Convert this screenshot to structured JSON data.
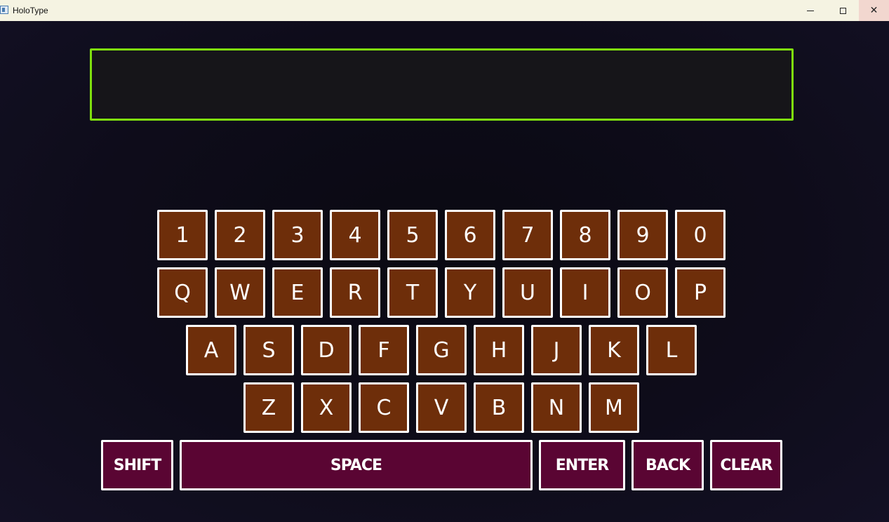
{
  "window": {
    "title": "HoloType",
    "minimize_glyph": "",
    "maximize_glyph": "",
    "close_glyph": "✕"
  },
  "display": {
    "text": ""
  },
  "keyboard": {
    "row1": [
      "1",
      "2",
      "3",
      "4",
      "5",
      "6",
      "7",
      "8",
      "9",
      "0"
    ],
    "row2": [
      "Q",
      "W",
      "E",
      "R",
      "T",
      "Y",
      "U",
      "I",
      "O",
      "P"
    ],
    "row3": [
      "A",
      "S",
      "D",
      "F",
      "G",
      "H",
      "J",
      "K",
      "L"
    ],
    "row4": [
      "Z",
      "X",
      "C",
      "V",
      "B",
      "N",
      "M"
    ],
    "functions": {
      "shift": "SHIFT",
      "space": "SPACE",
      "enter": "ENTER",
      "back": "BACK",
      "clear": "CLEAR"
    }
  },
  "colors": {
    "display_border": "#7fdf0e",
    "key_background": "#6e2e0a",
    "function_key_background": "#5a0533",
    "key_border": "#ffffff",
    "background": "#0d0b17"
  }
}
